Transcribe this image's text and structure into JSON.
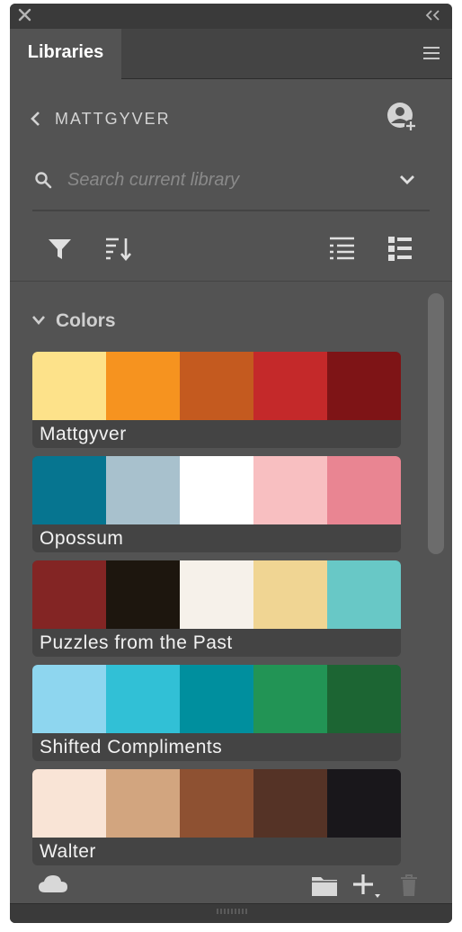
{
  "panel": {
    "close_icon": "close-icon",
    "collapse_icon": "double-chevron-left-icon",
    "tab_label": "Libraries",
    "menu_icon": "hamburger-menu-icon"
  },
  "library": {
    "name": "MATTGYVER",
    "back_icon": "chevron-left-icon",
    "share_icon": "add-person-icon"
  },
  "search": {
    "placeholder": "Search current library",
    "value": "",
    "icon": "search-icon",
    "dropdown_icon": "chevron-down-icon"
  },
  "toolbar": {
    "filter_icon": "filter-icon",
    "sort_icon": "sort-icon",
    "list_view_icon": "list-view-icon",
    "grid_view_icon": "compact-list-view-icon"
  },
  "colors_section": {
    "title": "Colors",
    "expanded": true,
    "themes": [
      {
        "name": "Mattgyver",
        "swatches": [
          "#fde28a",
          "#f6931f",
          "#c45a1f",
          "#c4292a",
          "#7e1416"
        ]
      },
      {
        "name": "Opossum",
        "swatches": [
          "#067590",
          "#a8c1cd",
          "#ffffff",
          "#f8bfc1",
          "#e98592"
        ]
      },
      {
        "name": "Puzzles from the Past",
        "swatches": [
          "#832524",
          "#1d160e",
          "#f6f1ea",
          "#f0d593",
          "#68c8c6"
        ]
      },
      {
        "name": "Shifted Compliments",
        "swatches": [
          "#8ed6ef",
          "#31c0d6",
          "#008f9e",
          "#229455",
          "#1c6533"
        ]
      },
      {
        "name": "Walter",
        "swatches": [
          "#f9e4d6",
          "#d2a57f",
          "#8e5132",
          "#553326",
          "#19171b"
        ]
      }
    ]
  },
  "bottom_bar": {
    "cloud_icon": "cloud-icon",
    "folder_icon": "folder-icon",
    "add_icon": "add-plus-icon",
    "trash_icon": "trash-icon"
  },
  "colors": {
    "panel_bg": "#535353",
    "header_bg": "#444444",
    "frame_bg": "#2c2c2c",
    "text_light": "#d4d4d4"
  }
}
